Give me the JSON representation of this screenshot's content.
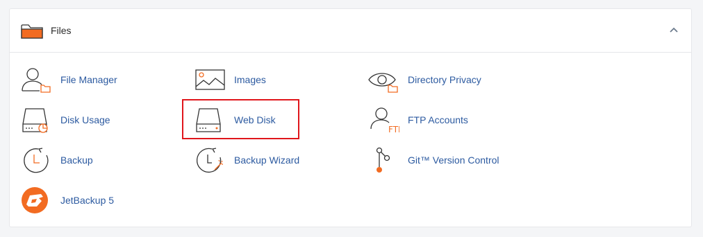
{
  "section": {
    "title": "Files",
    "collapse_icon": "chevron-up-icon"
  },
  "items": [
    {
      "label": "File Manager",
      "icon": "file-manager-icon"
    },
    {
      "label": "Images",
      "icon": "images-icon"
    },
    {
      "label": "Directory Privacy",
      "icon": "directory-privacy-icon"
    },
    {
      "label": "Disk Usage",
      "icon": "disk-usage-icon"
    },
    {
      "label": "Web Disk",
      "icon": "web-disk-icon"
    },
    {
      "label": "FTP Accounts",
      "icon": "ftp-accounts-icon"
    },
    {
      "label": "Backup",
      "icon": "backup-icon"
    },
    {
      "label": "Backup Wizard",
      "icon": "backup-wizard-icon"
    },
    {
      "label": "Git™ Version Control",
      "icon": "git-version-control-icon"
    },
    {
      "label": "JetBackup 5",
      "icon": "jetbackup-icon"
    }
  ],
  "ftp_icon_text": "FTP",
  "colors": {
    "accent_orange": "#f26b21",
    "link_blue": "#2c5aa0",
    "highlight_red": "#e0151b"
  }
}
